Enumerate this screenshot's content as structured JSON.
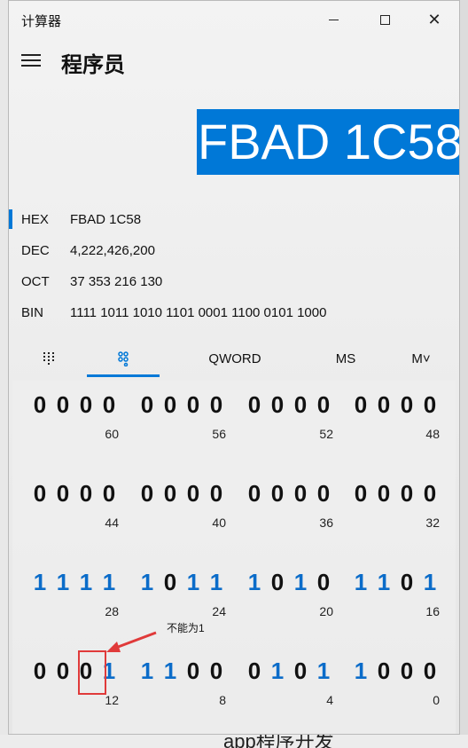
{
  "window": {
    "app_title": "计算器",
    "mode_title": "程序员"
  },
  "display": {
    "value": "FBAD 1C58"
  },
  "radix": [
    {
      "name": "HEX",
      "value": "FBAD 1C58",
      "active": true
    },
    {
      "name": "DEC",
      "value": "4,222,426,200",
      "active": false
    },
    {
      "name": "OCT",
      "value": "37 353 216 130",
      "active": false
    },
    {
      "name": "BIN",
      "value": "1111 1011 1010 1101 0001 1100 0101 1000",
      "active": false
    }
  ],
  "tabs": {
    "keypad_icon": "keypad-icon",
    "bits_icon": "bit-toggle-icon",
    "word": "QWORD",
    "ms": "MS",
    "mplus": "M˅"
  },
  "bits": [
    {
      "groups": [
        {
          "bits": [
            "0",
            "0",
            "0",
            "0"
          ],
          "pos": "60"
        },
        {
          "bits": [
            "0",
            "0",
            "0",
            "0"
          ],
          "pos": "56"
        },
        {
          "bits": [
            "0",
            "0",
            "0",
            "0"
          ],
          "pos": "52"
        },
        {
          "bits": [
            "0",
            "0",
            "0",
            "0"
          ],
          "pos": "48"
        }
      ]
    },
    {
      "groups": [
        {
          "bits": [
            "0",
            "0",
            "0",
            "0"
          ],
          "pos": "44"
        },
        {
          "bits": [
            "0",
            "0",
            "0",
            "0"
          ],
          "pos": "40"
        },
        {
          "bits": [
            "0",
            "0",
            "0",
            "0"
          ],
          "pos": "36"
        },
        {
          "bits": [
            "0",
            "0",
            "0",
            "0"
          ],
          "pos": "32"
        }
      ]
    },
    {
      "groups": [
        {
          "bits": [
            "1",
            "1",
            "1",
            "1"
          ],
          "pos": "28"
        },
        {
          "bits": [
            "1",
            "0",
            "1",
            "1"
          ],
          "pos": "24"
        },
        {
          "bits": [
            "1",
            "0",
            "1",
            "0"
          ],
          "pos": "20"
        },
        {
          "bits": [
            "1",
            "1",
            "0",
            "1"
          ],
          "pos": "16"
        }
      ]
    },
    {
      "groups": [
        {
          "bits": [
            "0",
            "0",
            "0",
            "1"
          ],
          "pos": "12"
        },
        {
          "bits": [
            "1",
            "1",
            "0",
            "0"
          ],
          "pos": "8"
        },
        {
          "bits": [
            "0",
            "1",
            "0",
            "1"
          ],
          "pos": "4"
        },
        {
          "bits": [
            "1",
            "0",
            "0",
            "0"
          ],
          "pos": "0"
        }
      ]
    }
  ],
  "annotation": {
    "text": "不能为1"
  },
  "background": {
    "bottom_text": "app程序开发"
  },
  "colors": {
    "accent": "#0078d7",
    "bit_one": "#0b6cc9",
    "annotation": "#e03a3a"
  }
}
